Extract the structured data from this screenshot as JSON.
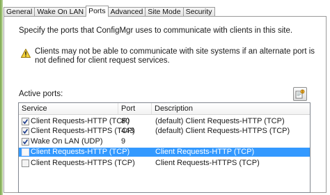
{
  "tabs": [
    {
      "label": "General",
      "active": false
    },
    {
      "label": "Wake On LAN",
      "active": false
    },
    {
      "label": "Ports",
      "active": true
    },
    {
      "label": "Advanced",
      "active": false
    },
    {
      "label": "Site Mode",
      "active": false
    },
    {
      "label": "Security",
      "active": false
    }
  ],
  "intro_text": "Specify the ports that ConfigMgr uses to communicate with clients in this site.",
  "warning": {
    "icon": "warning-triangle-icon",
    "text": "Clients may not be able to communicate with site systems if an alternate port is not defined for client request services."
  },
  "active_ports_label": "Active ports:",
  "properties_button": {
    "icon": "properties-icon"
  },
  "ports_table": {
    "columns": [
      "Service",
      "Port",
      "Description"
    ],
    "rows": [
      {
        "checked": true,
        "service": "Client Requests-HTTP (TCP)",
        "port": "80",
        "description": "(default) Client Requests-HTTP (TCP)",
        "selected": false
      },
      {
        "checked": true,
        "service": "Client Requests-HTTPS (TCP)",
        "port": "443",
        "description": "(default) Client Requests-HTTPS (TCP)",
        "selected": false
      },
      {
        "checked": true,
        "service": "Wake On LAN (UDP)",
        "port": "9",
        "description": "",
        "selected": false
      },
      {
        "checked": false,
        "service": "Client Requests-HTTP (TCP)",
        "port": "",
        "description": "Client Requests-HTTP (TCP)",
        "selected": true
      },
      {
        "checked": false,
        "service": "Client Requests-HTTPS (TCP)",
        "port": "",
        "description": "Client Requests-HTTPS (TCP)",
        "selected": false
      }
    ]
  },
  "colors": {
    "selection": "#3399ff",
    "warning_fill": "#f5d33a",
    "border": "#9b9b9b"
  }
}
